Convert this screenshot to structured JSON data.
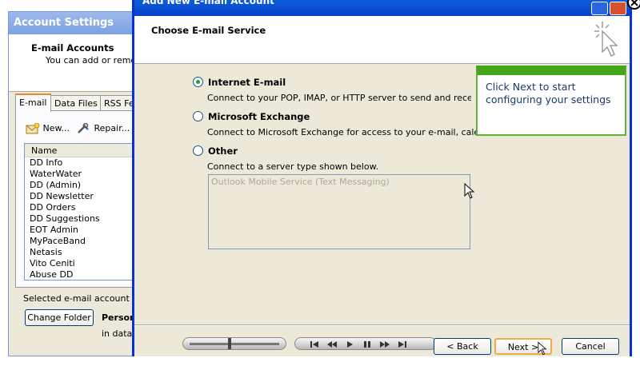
{
  "background_window": {
    "title": "Account Settings",
    "header_title": "E-mail Accounts",
    "header_subtitle": "You can add or remove",
    "tabs": [
      {
        "label": "E-mail",
        "active": true
      },
      {
        "label": "Data Files",
        "active": false
      },
      {
        "label": "RSS Fee",
        "active": false
      }
    ],
    "toolbar": {
      "new_label": "New...",
      "repair_label": "Repair..."
    },
    "list": {
      "column_header": "Name",
      "items": [
        "DD Info",
        "WaterWater",
        "DD (Admin)",
        "DD Newsletter",
        "DD Orders",
        "DD Suggestions",
        "EOT Admin",
        "MyPaceBand",
        "Netasis",
        "Vito Ceniti",
        "Abuse DD"
      ]
    },
    "footer_text": "Selected e-mail account deliv",
    "change_folder_label": "Change Folder",
    "personal_label": "Person",
    "in_data_label": "in data f"
  },
  "wizard": {
    "title": "Add New E-mail Account",
    "header_title": "Choose E-mail Service",
    "options": [
      {
        "label": "Internet E-mail",
        "selected": true,
        "description": "Connect to your POP, IMAP, or HTTP server to send and receive e-ma"
      },
      {
        "label": "Microsoft Exchange",
        "selected": false,
        "description": "Connect to Microsoft Exchange for access to your e-mail, calendar, co"
      },
      {
        "label": "Other",
        "selected": false,
        "description": "Connect to a server type shown below."
      }
    ],
    "other_service_item": "Outlook Mobile Service (Text Messaging)",
    "buttons": {
      "back": "< Back",
      "next": "Next >",
      "cancel": "Cancel"
    }
  },
  "callout": {
    "text": "Click Next to start configuring your settings"
  },
  "colors": {
    "accent_green": "#42a51a",
    "titlebar_blue": "#0a5ddc"
  },
  "icons": [
    "new-mail-icon",
    "repair-icon",
    "wizard-sparkle-icon",
    "close-icon",
    "media-controls"
  ]
}
